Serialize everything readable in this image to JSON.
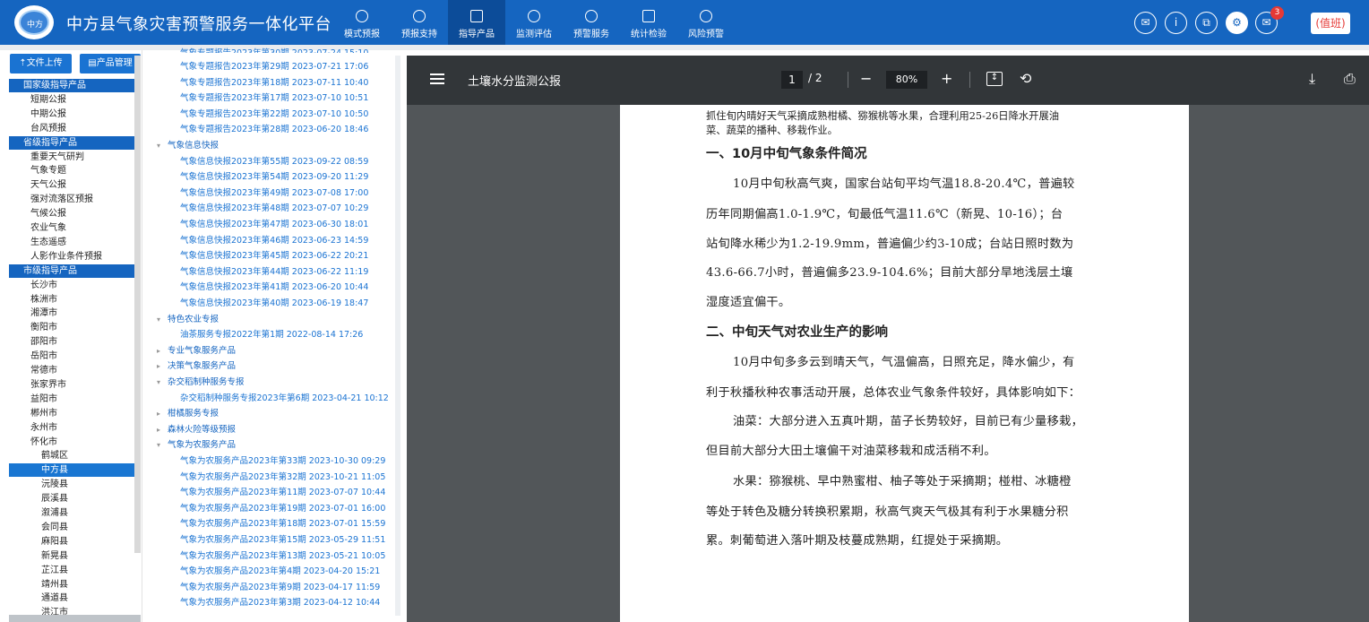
{
  "header": {
    "logo_text": "中方",
    "title": "中方县气象灾害预警服务一体化平台",
    "nav": [
      {
        "label": "模式预报",
        "icon": "globe-icon"
      },
      {
        "label": "预报支持",
        "icon": "dashboard-icon"
      },
      {
        "label": "指导产品",
        "icon": "document-icon"
      },
      {
        "label": "监测评估",
        "icon": "radar-icon"
      },
      {
        "label": "预警服务",
        "icon": "alarm-bell-icon"
      },
      {
        "label": "统计检验",
        "icon": "monitor-chart-icon"
      },
      {
        "label": "风险预警",
        "icon": "lightning-icon"
      }
    ],
    "active_nav": "指导产品",
    "right_icons": [
      {
        "glyph": "✉",
        "name": "shirt-icon"
      },
      {
        "glyph": "i",
        "name": "info-icon"
      },
      {
        "glyph": "⧉",
        "name": "portal-icon"
      },
      {
        "glyph": "⚙",
        "name": "settings-icon"
      },
      {
        "glyph": "✉",
        "name": "mail-icon"
      }
    ],
    "mail_count": "3",
    "duty_label": "(值班)"
  },
  "left_panel": {
    "upload_button": "文件上传",
    "manage_button": "产品管理",
    "tree": [
      {
        "label": "国家级指导产品",
        "type": "header"
      },
      {
        "label": "短期公报",
        "type": "l1"
      },
      {
        "label": "中期公报",
        "type": "l1"
      },
      {
        "label": "台风预报",
        "type": "l1"
      },
      {
        "label": "省级指导产品",
        "type": "header"
      },
      {
        "label": "重要天气研判",
        "type": "l1"
      },
      {
        "label": "气象专题",
        "type": "l1"
      },
      {
        "label": "天气公报",
        "type": "l1"
      },
      {
        "label": "强对流落区预报",
        "type": "l1"
      },
      {
        "label": "气候公报",
        "type": "l1"
      },
      {
        "label": "农业气象",
        "type": "l1"
      },
      {
        "label": "生态遥感",
        "type": "l1"
      },
      {
        "label": "人影作业条件预报",
        "type": "l1"
      },
      {
        "label": "市级指导产品",
        "type": "header"
      },
      {
        "label": "长沙市",
        "type": "l1"
      },
      {
        "label": "株洲市",
        "type": "l1"
      },
      {
        "label": "湘潭市",
        "type": "l1"
      },
      {
        "label": "衡阳市",
        "type": "l1"
      },
      {
        "label": "邵阳市",
        "type": "l1"
      },
      {
        "label": "岳阳市",
        "type": "l1"
      },
      {
        "label": "常德市",
        "type": "l1"
      },
      {
        "label": "张家界市",
        "type": "l1"
      },
      {
        "label": "益阳市",
        "type": "l1"
      },
      {
        "label": "郴州市",
        "type": "l1"
      },
      {
        "label": "永州市",
        "type": "l1"
      },
      {
        "label": "怀化市",
        "type": "l1"
      },
      {
        "label": "鹤城区",
        "type": "l2"
      },
      {
        "label": "中方县",
        "type": "selected"
      },
      {
        "label": "沅陵县",
        "type": "l2"
      },
      {
        "label": "辰溪县",
        "type": "l2"
      },
      {
        "label": "溆浦县",
        "type": "l2"
      },
      {
        "label": "会同县",
        "type": "l2"
      },
      {
        "label": "麻阳县",
        "type": "l2"
      },
      {
        "label": "新晃县",
        "type": "l2"
      },
      {
        "label": "芷江县",
        "type": "l2"
      },
      {
        "label": "靖州县",
        "type": "l2"
      },
      {
        "label": "通道县",
        "type": "l2"
      },
      {
        "label": "洪江市",
        "type": "l2"
      }
    ]
  },
  "middle_panel": {
    "top_partial": "气象专题报告2023年第30期 2023-07-24 15:10",
    "rows": [
      {
        "label": "气象专题报告2023年第29期 2023-07-21 17:06",
        "type": "child"
      },
      {
        "label": "气象专题报告2023年第18期 2023-07-11 10:40",
        "type": "child"
      },
      {
        "label": "气象专题报告2023年第17期 2023-07-10 10:51",
        "type": "child"
      },
      {
        "label": "气象专题报告2023年第22期 2023-07-10 10:50",
        "type": "child"
      },
      {
        "label": "气象专题报告2023年第28期 2023-06-20 18:46",
        "type": "child"
      },
      {
        "label": "气象信息快报",
        "type": "group",
        "open": true
      },
      {
        "label": "气象信息快报2023年第55期 2023-09-22 08:59",
        "type": "child"
      },
      {
        "label": "气象信息快报2023年第54期 2023-09-20 11:29",
        "type": "child"
      },
      {
        "label": "气象信息快报2023年第49期 2023-07-08 17:00",
        "type": "child"
      },
      {
        "label": "气象信息快报2023年第48期 2023-07-07 10:29",
        "type": "child"
      },
      {
        "label": "气象信息快报2023年第47期 2023-06-30 18:01",
        "type": "child"
      },
      {
        "label": "气象信息快报2023年第46期 2023-06-23 14:59",
        "type": "child"
      },
      {
        "label": "气象信息快报2023年第45期 2023-06-22 20:21",
        "type": "child"
      },
      {
        "label": "气象信息快报2023年第44期 2023-06-22 11:19",
        "type": "child"
      },
      {
        "label": "气象信息快报2023年第41期 2023-06-20 10:44",
        "type": "child"
      },
      {
        "label": "气象信息快报2023年第40期 2023-06-19 18:47",
        "type": "child"
      },
      {
        "label": "特色农业专报",
        "type": "group",
        "open": true
      },
      {
        "label": "油茶服务专报2022年第1期 2022-08-14 17:26",
        "type": "child"
      },
      {
        "label": "专业气象服务产品",
        "type": "group",
        "open": false
      },
      {
        "label": "决策气象服务产品",
        "type": "group",
        "open": false
      },
      {
        "label": "杂交稻制种服务专报",
        "type": "group",
        "open": true
      },
      {
        "label": "杂交稻制种服务专报2023年第6期 2023-04-21 10:12",
        "type": "child"
      },
      {
        "label": "柑橘服务专报",
        "type": "group",
        "open": false
      },
      {
        "label": "森林火险等级预报",
        "type": "group",
        "open": false
      },
      {
        "label": "气象为农服务产品",
        "type": "group",
        "open": true
      },
      {
        "label": "气象为农服务产品2023年第33期 2023-10-30 09:29",
        "type": "child"
      },
      {
        "label": "气象为农服务产品2023年第32期 2023-10-21 11:05",
        "type": "child"
      },
      {
        "label": "气象为农服务产品2023年第11期 2023-07-07 10:44",
        "type": "child"
      },
      {
        "label": "气象为农服务产品2023年第19期 2023-07-01 16:00",
        "type": "child"
      },
      {
        "label": "气象为农服务产品2023年第18期 2023-07-01 15:59",
        "type": "child"
      },
      {
        "label": "气象为农服务产品2023年第15期 2023-05-29 11:51",
        "type": "child"
      },
      {
        "label": "气象为农服务产品2023年第13期 2023-05-21 10:05",
        "type": "child"
      },
      {
        "label": "气象为农服务产品2023年第4期 2023-04-20 15:21",
        "type": "child"
      },
      {
        "label": "气象为农服务产品2023年第9期 2023-04-17 11:59",
        "type": "child"
      },
      {
        "label": "气象为农服务产品2023年第3期 2023-04-12 10:44",
        "type": "child"
      }
    ]
  },
  "pdf": {
    "title": "土壤水分监测公报",
    "page_current": "1",
    "page_total": "/  2",
    "zoom": "80%",
    "lines": [
      {
        "text": "抓住旬内晴好天气采摘成熟柑橘、猕猴桃等水果，合理利用25-26日降水开展油",
        "kind": "small"
      },
      {
        "text": "菜、蔬菜的播种、移栽作业。",
        "kind": "small"
      },
      {
        "text": "一、10月中旬气象条件简况",
        "kind": "heading"
      },
      {
        "text": "10月中旬秋高气爽，国家台站旬平均气温18.8-20.4℃，普遍较",
        "kind": "indent"
      },
      {
        "text": "历年同期偏高1.0-1.9℃，旬最低气温11.6℃（新晃、10-16）；台",
        "kind": "body"
      },
      {
        "text": "站旬降水稀少为1.2-19.9mm，普遍偏少约3-10成；台站日照时数为",
        "kind": "body"
      },
      {
        "text": "43.6-66.7小时，普遍偏多23.9-104.6%；目前大部分旱地浅层土壤",
        "kind": "body"
      },
      {
        "text": "湿度适宜偏干。",
        "kind": "body"
      },
      {
        "text": "二、中旬天气对农业生产的影响",
        "kind": "heading"
      },
      {
        "text": "10月中旬多多云到晴天气，气温偏高，日照充足，降水偏少，有",
        "kind": "indent"
      },
      {
        "text": "利于秋播秋种农事活动开展，总体农业气象条件较好，具体影响如下：",
        "kind": "body"
      },
      {
        "text": "油菜：大部分进入五真叶期，苗子长势较好，目前已有少量移栽，",
        "kind": "indent"
      },
      {
        "text": "但目前大部分大田土壤偏干对油菜移栽和成活稍不利。",
        "kind": "body"
      },
      {
        "text": "水果：猕猴桃、早中熟蜜柑、柚子等处于采摘期；椪柑、冰糖橙",
        "kind": "indent"
      },
      {
        "text": "等处于转色及糖分转换积累期，秋高气爽天气极其有利于水果糖分积",
        "kind": "body"
      },
      {
        "text": "累。刺葡萄进入落叶期及枝蔓成熟期，红提处于采摘期。",
        "kind": "body"
      }
    ]
  },
  "colors": {
    "header_bg": "#1565c0",
    "active_nav_bg": "#0c4c99",
    "accent": "#1976d2",
    "pdf_toolbar": "#323639",
    "pdf_bg": "#525659"
  }
}
